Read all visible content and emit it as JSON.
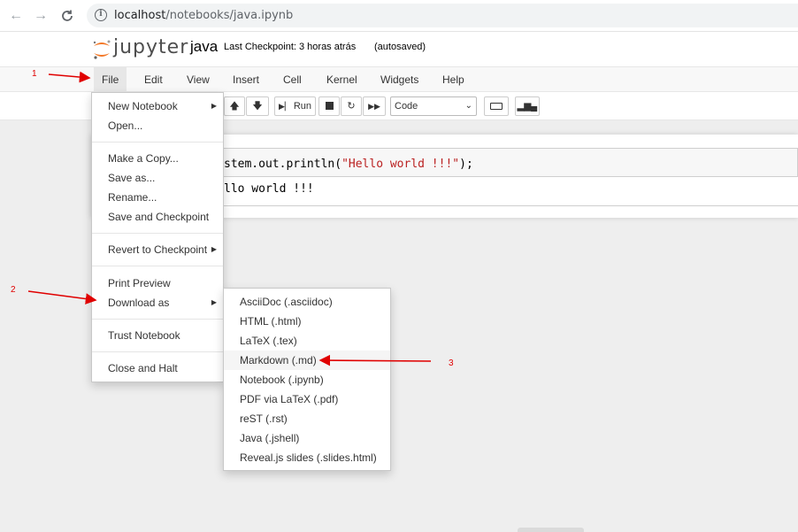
{
  "browser": {
    "back_icon": "arrow-left-icon",
    "forward_icon": "arrow-right-icon",
    "reload_icon": "reload-icon",
    "info_icon": "info-icon",
    "url_host": "localhost",
    "url_path": "/notebooks/java.ipynb"
  },
  "header": {
    "logo_text": "jupyter",
    "notebook_name": "java",
    "checkpoint": "Last Checkpoint: 3 horas atrás",
    "autosave": "(autosaved)"
  },
  "menubar": {
    "items": [
      "File",
      "Edit",
      "View",
      "Insert",
      "Cell",
      "Kernel",
      "Widgets",
      "Help"
    ],
    "active": "File"
  },
  "toolbar": {
    "run_label": "Run",
    "cell_type": "Code"
  },
  "cell": {
    "code_prefix": "stem.out.println(",
    "code_string": "\"Hello world !!!\"",
    "code_suffix": ");",
    "output": "llo world !!!"
  },
  "file_menu": {
    "new_notebook": "New Notebook",
    "open": "Open...",
    "make_copy": "Make a Copy...",
    "save_as": "Save as...",
    "rename": "Rename...",
    "save_checkpoint": "Save and Checkpoint",
    "revert": "Revert to Checkpoint",
    "print_preview": "Print Preview",
    "download_as": "Download as",
    "trust": "Trust Notebook",
    "close_halt": "Close and Halt"
  },
  "download_menu": {
    "items": [
      "AsciiDoc (.asciidoc)",
      "HTML (.html)",
      "LaTeX (.tex)",
      "Markdown (.md)",
      "Notebook (.ipynb)",
      "PDF via LaTeX (.pdf)",
      "reST (.rst)",
      "Java (.jshell)",
      "Reveal.js slides (.slides.html)"
    ],
    "highlighted_index": 3
  },
  "annotations": {
    "labels": [
      "1",
      "2",
      "3"
    ],
    "color": "#e00000"
  },
  "colors": {
    "menubar_bg": "#f8f8f8",
    "active_menu_bg": "#e7e7e7",
    "page_bg": "#eeeeee",
    "logo_orange": "#f37726"
  }
}
